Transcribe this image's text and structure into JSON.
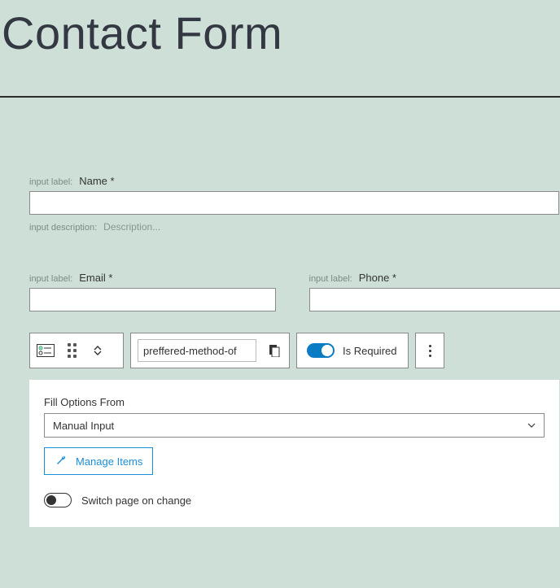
{
  "header": {
    "title": "Contact Form"
  },
  "meta": {
    "input_label": "input label:",
    "input_description": "input description:"
  },
  "fields": {
    "name": {
      "label": "Name *",
      "value": "",
      "description_placeholder": "Description..."
    },
    "email": {
      "label": "Email *",
      "value": ""
    },
    "phone": {
      "label": "Phone *",
      "value": ""
    }
  },
  "widget": {
    "field_id": "preffered-method-of",
    "is_required_label": "Is Required",
    "is_required": true
  },
  "options": {
    "title": "Fill Options From",
    "selected": "Manual Input",
    "manage_label": "Manage Items",
    "switch_label": "Switch page on change",
    "switch_on": false
  }
}
